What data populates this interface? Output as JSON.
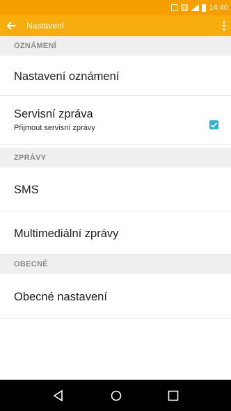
{
  "status_bar": {
    "time": "14:40",
    "icons": [
      "nfc-icon",
      "sim-icon",
      "signal-icon",
      "battery-icon"
    ],
    "color": "#f5a000"
  },
  "app_bar": {
    "title": "Nastavení",
    "color": "#f7ad0d"
  },
  "sections": [
    {
      "header": "OZNÁMENÍ",
      "items": [
        {
          "title": "Nastavení oznámení"
        },
        {
          "title": "Servisní zpráva",
          "subtitle": "Přijmout servisní zprávy",
          "checked": true
        }
      ]
    },
    {
      "header": "ZPRÁVY",
      "items": [
        {
          "title": "SMS"
        },
        {
          "title": "Multimediální zprávy"
        }
      ]
    },
    {
      "header": "OBECNÉ",
      "items": [
        {
          "title": "Obecné nastavení"
        }
      ]
    }
  ],
  "nav_bar": {
    "buttons": [
      "back-triangle-icon",
      "home-circle-icon",
      "recents-square-icon"
    ]
  },
  "accent_color": "#2bb1d8"
}
